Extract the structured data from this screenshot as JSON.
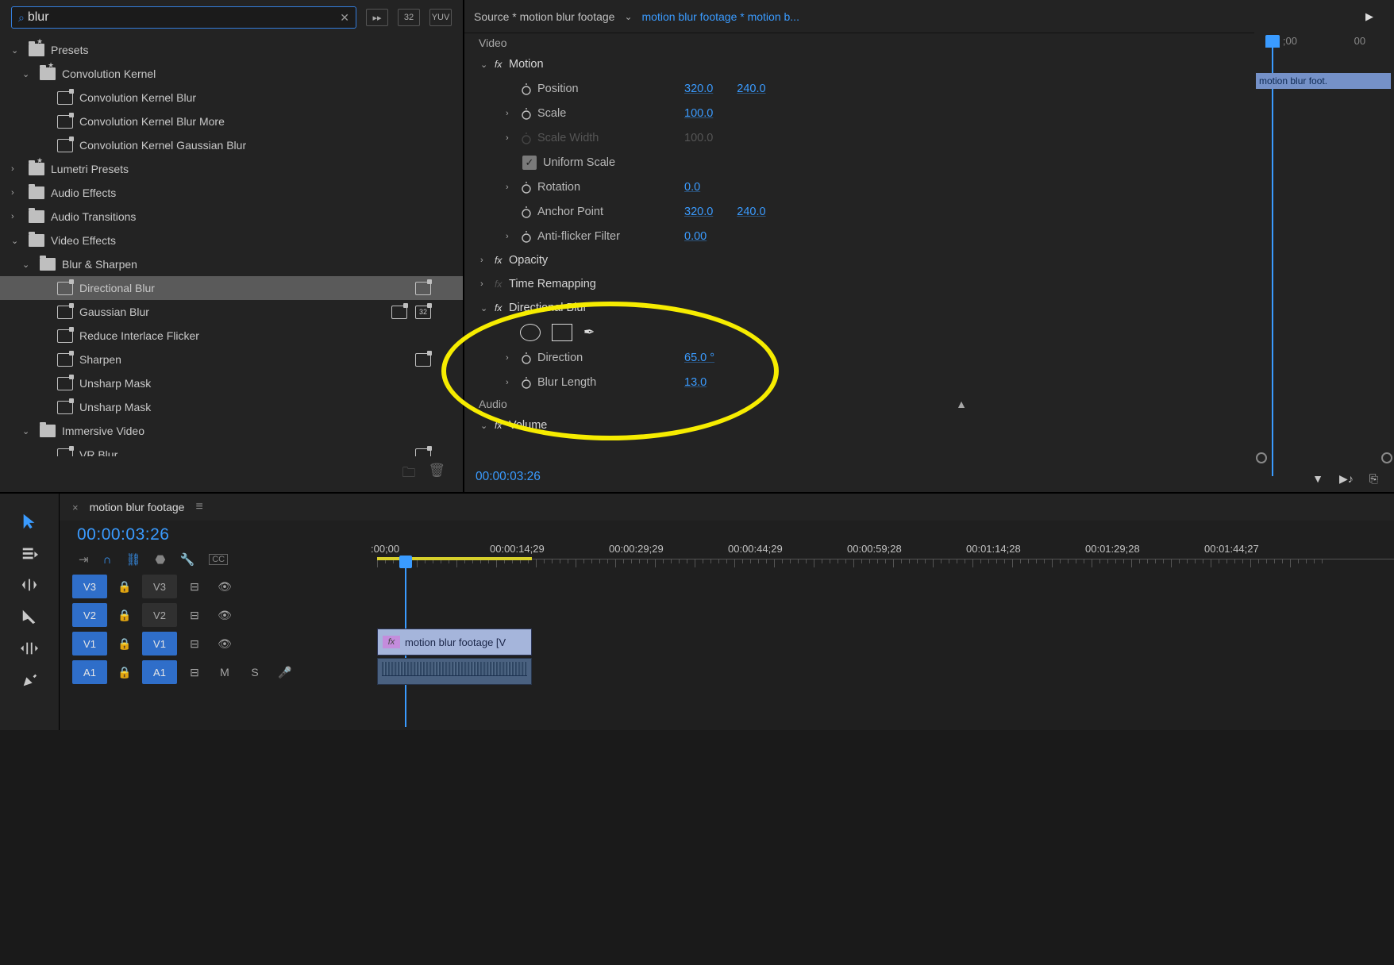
{
  "search": {
    "value": "blur"
  },
  "toolbar_icons": [
    "fx-panel",
    "32-bit",
    "yuv"
  ],
  "tree": [
    {
      "d": 0,
      "arrow": "down",
      "fol": "star",
      "label": "Presets"
    },
    {
      "d": 1,
      "arrow": "down",
      "fol": "star",
      "label": "Convolution Kernel"
    },
    {
      "d": 2,
      "pi": true,
      "label": "Convolution Kernel Blur"
    },
    {
      "d": 2,
      "pi": true,
      "label": "Convolution Kernel Blur More"
    },
    {
      "d": 2,
      "pi": true,
      "label": "Convolution Kernel Gaussian Blur"
    },
    {
      "d": 0,
      "arrow": "right",
      "fol": "star",
      "label": "Lumetri Presets"
    },
    {
      "d": 0,
      "arrow": "right",
      "fol": "plain",
      "label": "Audio Effects"
    },
    {
      "d": 0,
      "arrow": "right",
      "fol": "plain",
      "label": "Audio Transitions"
    },
    {
      "d": 0,
      "arrow": "down",
      "fol": "plain",
      "label": "Video Effects"
    },
    {
      "d": 1,
      "arrow": "down",
      "fol": "plain",
      "label": "Blur & Sharpen"
    },
    {
      "d": 2,
      "pi": true,
      "label": "Directional Blur",
      "selected": true,
      "b": [
        "hw"
      ]
    },
    {
      "d": 2,
      "pi": true,
      "label": "Gaussian Blur",
      "b": [
        "hw",
        "32"
      ]
    },
    {
      "d": 2,
      "pi": true,
      "label": "Reduce Interlace Flicker"
    },
    {
      "d": 2,
      "pi": true,
      "label": "Sharpen",
      "b": [
        "hw"
      ]
    },
    {
      "d": 2,
      "pi": true,
      "label": "Unsharp Mask"
    },
    {
      "d": 2,
      "pi": true,
      "label": "Unsharp Mask"
    },
    {
      "d": 1,
      "arrow": "down",
      "fol": "plain",
      "label": "Immersive Video"
    },
    {
      "d": 2,
      "pi": true,
      "label": "VR Blur",
      "b": [
        "hw"
      ]
    }
  ],
  "effect_controls": {
    "source_label": "Source * motion blur footage",
    "sequence_label": "motion blur footage * motion b...",
    "section_video": "Video",
    "section_audio": "Audio",
    "groups": {
      "motion": "Motion",
      "opacity": "Opacity",
      "time_remapping": "Time Remapping",
      "directional_blur": "Directional Blur",
      "volume": "Volume"
    },
    "motion": {
      "position": {
        "label": "Position",
        "x": "320.0",
        "y": "240.0"
      },
      "scale": {
        "label": "Scale",
        "v": "100.0"
      },
      "scale_width": {
        "label": "Scale Width",
        "v": "100.0"
      },
      "uniform_scale": {
        "label": "Uniform Scale"
      },
      "rotation": {
        "label": "Rotation",
        "v": "0.0"
      },
      "anchor": {
        "label": "Anchor Point",
        "x": "320.0",
        "y": "240.0"
      },
      "anti_flicker": {
        "label": "Anti-flicker Filter",
        "v": "0.00"
      }
    },
    "dblur": {
      "direction": {
        "label": "Direction",
        "v": "65.0 °"
      },
      "blur_length": {
        "label": "Blur Length",
        "v": "13.0"
      }
    },
    "timecode": "00:00:03:26",
    "mini_clip": "motion blur foot.",
    "mini_ticks": [
      ";00",
      "00"
    ]
  },
  "timeline": {
    "sequence": "motion blur footage",
    "timecode": "00:00:03:26",
    "ruler": [
      ":00;00",
      "00:00:14;29",
      "00:00:29;29",
      "00:00:44;29",
      "00:00:59;28",
      "00:01:14;28",
      "00:01:29;28",
      "00:01:44;27"
    ],
    "tracks": [
      "V3",
      "V2",
      "V1",
      "A1"
    ],
    "clip_v": "motion blur footage [V"
  }
}
